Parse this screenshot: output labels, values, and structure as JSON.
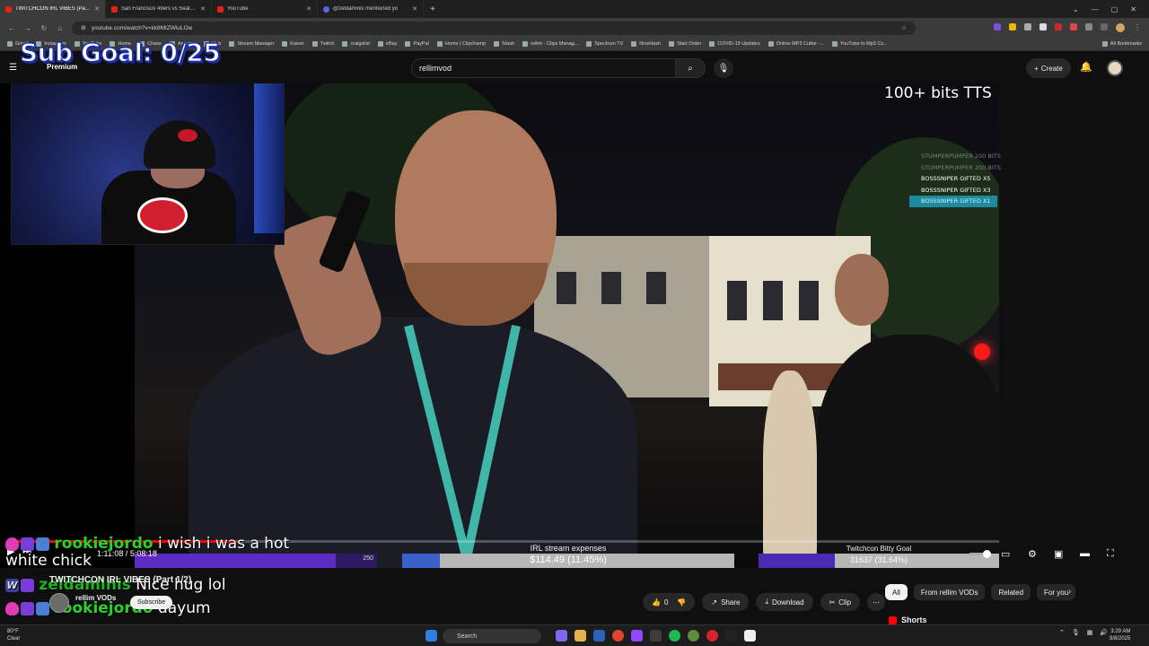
{
  "browser": {
    "tabs": [
      {
        "title": "TWITCHCON IRL VIBES (Part 1/",
        "active": true,
        "favicon": "youtube"
      },
      {
        "title": "San Francisco 49ers vs Seattle S",
        "active": false,
        "favicon": "youtube"
      },
      {
        "title": "YouTube",
        "active": false,
        "favicon": "youtube"
      },
      {
        "title": "@zeldaminis mentioned yo",
        "active": false,
        "favicon": "discord"
      }
    ],
    "url": "youtube.com/watch?v=kk8MIZWiuLOw",
    "bookmarks": [
      "Gmail",
      "Instagram",
      "YouTube",
      "Home",
      "Chase",
      "Amazon",
      "Hub",
      "Stream Manager",
      "Kaiser",
      "Twitch",
      "craigslist",
      "eBay",
      "PayPal",
      "Home | Clipchamp",
      "Stash",
      "rellim - Clips Manag...",
      "Spectrum TV",
      "NiceHash",
      "Start Order",
      "COVID-19 Updates",
      "Online MP3 Cutter -...",
      "YouTube to Mp3 Co..."
    ],
    "all_bookmarks": "All Bookmarks"
  },
  "youtube": {
    "premium_label": "Premium",
    "search_value": "rellimvod",
    "create_label": "Create"
  },
  "overlay": {
    "sub_goal": "Sub Goal: 0/25",
    "bits_tts": "100+ bits TTS",
    "alerts": [
      {
        "text": "STUMPERPUMPER 200 BITS",
        "style": "faded"
      },
      {
        "text": "STUMPERPUMPER 200 BITS",
        "style": "faded"
      },
      {
        "text": "BOSSSNIPER GIFTED X5",
        "style": "normal"
      },
      {
        "text": "BOSSSNIPER GIFTED X3",
        "style": "normal"
      },
      {
        "text": "BOSSSNIPER GIFTED X1",
        "style": "highlight"
      }
    ],
    "bar1_value": "250",
    "bar1_fill": 0.83,
    "expenses_label": "IRL stream expenses",
    "expenses_value": "$114.49 (11.45%)",
    "expenses_fill": 0.1145,
    "bitty_label": "Twitchcon Bitty Goal",
    "bitty_value": "31637 (31.64%)",
    "bitty_fill": 0.3164
  },
  "chat": [
    {
      "user": "rookiejordo",
      "message": "i wish i was a hot",
      "wrap": "white chick"
    },
    {
      "user": "zeldaminis",
      "message": "Nice hug lol"
    },
    {
      "user": "rookiejordo",
      "message": "dayum"
    }
  ],
  "player": {
    "time": "1:11:08 / 5:08:18",
    "progress": 0.23
  },
  "video_info": {
    "title": "TWITCHCON IRL VIBES (Part 1/2)",
    "channel": "rellim VODs",
    "subscribe": "Subscribe",
    "likes": "0",
    "share": "Share",
    "download": "Download",
    "clip": "Clip"
  },
  "sidebar_chips": [
    "All",
    "From rellim VODs",
    "Related",
    "For you"
  ],
  "shorts_label": "Shorts",
  "taskbar": {
    "weather_temp": "80°F",
    "weather_desc": "Clear",
    "search": "Search",
    "time": "3:29 AM",
    "date": "9/8/2025"
  }
}
